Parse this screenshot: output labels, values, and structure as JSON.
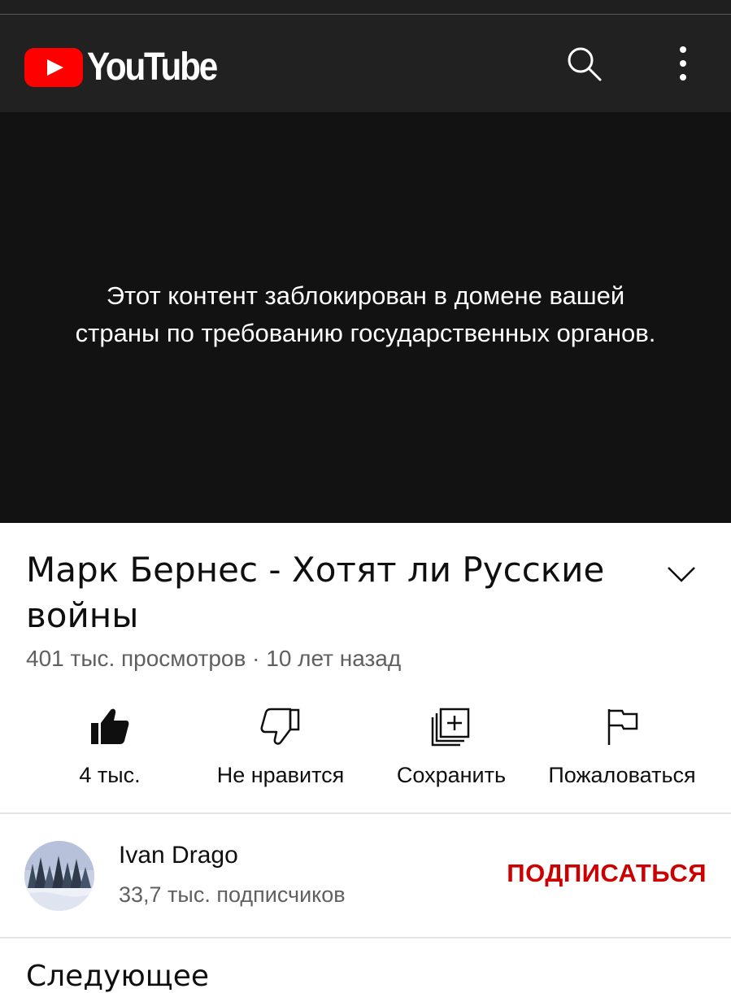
{
  "header": {
    "logo_text": "YouTube"
  },
  "player": {
    "blocked_line1": "Этот контент заблокирован в домене вашей",
    "blocked_line2": "страны по требованию государственных органов."
  },
  "video": {
    "title": "Марк Бернес - Хотят ли Русские войны",
    "meta": "401 тыс. просмотров · 10 лет назад"
  },
  "actions": {
    "like_label": "4 тыс.",
    "dislike_label": "Не нравится",
    "save_label": "Сохранить",
    "report_label": "Пожаловаться"
  },
  "channel": {
    "name": "Ivan Drago",
    "subscribers": "33,7 тыс. подписчиков",
    "subscribe_label": "ПОДПИСАТЬСЯ"
  },
  "next_section": {
    "heading": "Следующее"
  },
  "colors": {
    "brand_red": "#ff0000",
    "subscribe_red": "#cc0000",
    "header_bg": "#212121",
    "player_bg": "#121212"
  }
}
